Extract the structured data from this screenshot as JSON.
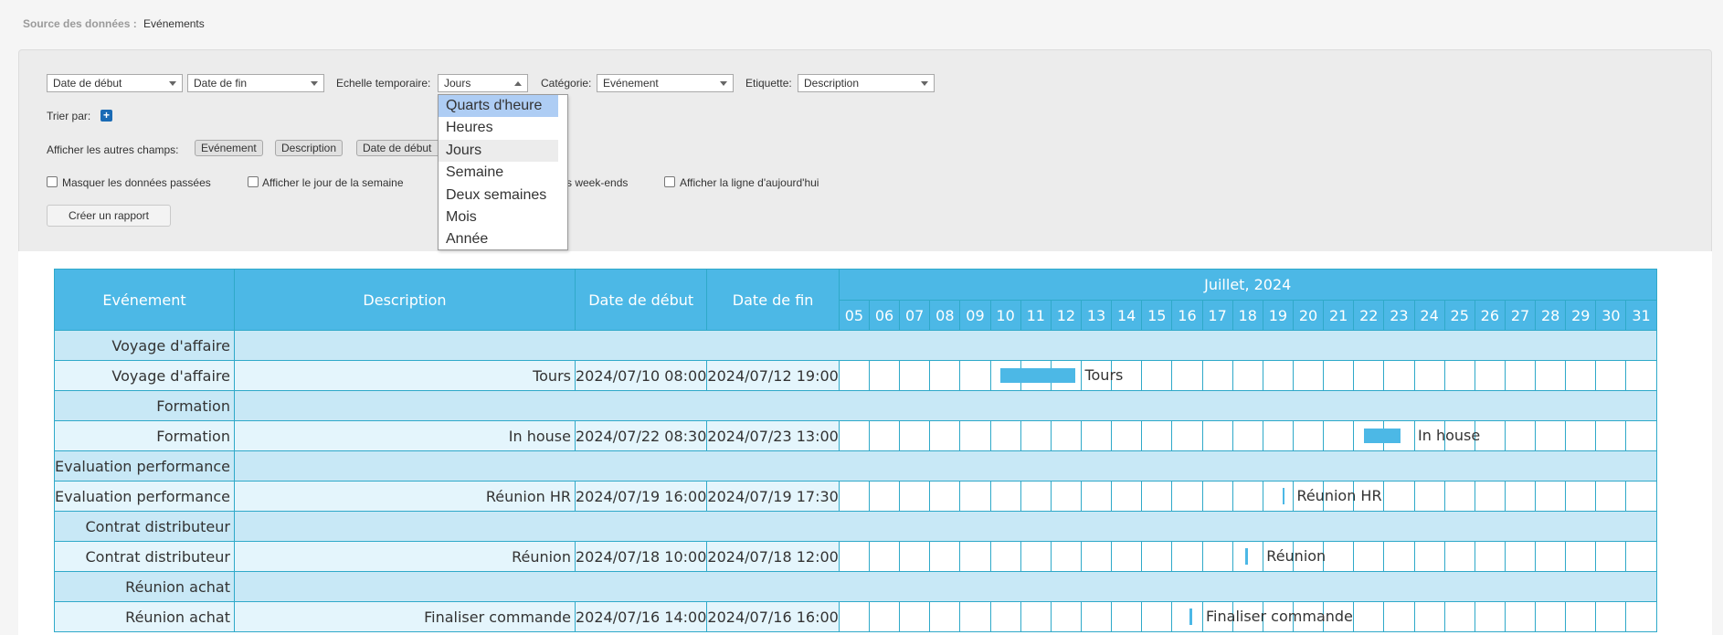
{
  "source": {
    "label": "Source des données :",
    "value": "Evénements"
  },
  "filters": {
    "start_date": "Date de début",
    "end_date": "Date de fin",
    "time_scale_label": "Echelle temporaire:",
    "time_scale_value": "Jours",
    "category_label": "Catégorie:",
    "category_value": "Evénement",
    "tag_label": "Etiquette:",
    "tag_value": "Description"
  },
  "sort_label": "Trier par:",
  "sort_add": "+",
  "other_fields_label": "Afficher les autres champs:",
  "other_fields": [
    "Evénement",
    "Description",
    "Date de début"
  ],
  "checkboxes": {
    "hide_past": "Masquer les données passées",
    "show_weekday": "Afficher le jour de la semaine",
    "weekends": "s week-ends",
    "today_line": "Afficher la ligne d'aujourd'hui"
  },
  "create_report": "Créer un rapport",
  "time_scale_options": [
    "Quarts d'heure",
    "Heures",
    "Jours",
    "Semaine",
    "Deux semaines",
    "Mois",
    "Année"
  ],
  "time_scale_highlighted": "Quarts d'heure",
  "gantt": {
    "headers": {
      "event": "Evénement",
      "description": "Description",
      "start": "Date de début",
      "end": "Date de fin",
      "month": "Juillet, 2024"
    },
    "days": [
      "05",
      "06",
      "07",
      "08",
      "09",
      "10",
      "11",
      "12",
      "13",
      "14",
      "15",
      "16",
      "17",
      "18",
      "19",
      "20",
      "21",
      "22",
      "23",
      "24",
      "25",
      "26",
      "27",
      "28",
      "29",
      "30",
      "31"
    ],
    "groups": [
      {
        "name": "Voyage d'affaire",
        "event": "Voyage d'affaire",
        "description": "Tours",
        "start": "2024/07/10 08:00",
        "end": "2024/07/12 19:00",
        "bar_label": "Tours"
      },
      {
        "name": "Formation",
        "event": "Formation",
        "description": "In house",
        "start": "2024/07/22 08:30",
        "end": "2024/07/23 13:00",
        "bar_label": "In house"
      },
      {
        "name": "Evaluation performance",
        "event": "Evaluation performance",
        "description": "Réunion HR",
        "start": "2024/07/19 16:00",
        "end": "2024/07/19 17:30",
        "bar_label": "Réunion HR"
      },
      {
        "name": "Contrat distributeur",
        "event": "Contrat distributeur",
        "description": "Réunion",
        "start": "2024/07/18 10:00",
        "end": "2024/07/18 12:00",
        "bar_label": "Réunion"
      },
      {
        "name": "Réunion achat",
        "event": "Réunion achat",
        "description": "Finaliser commande",
        "start": "2024/07/16 14:00",
        "end": "2024/07/16 16:00",
        "bar_label": "Finaliser commande"
      }
    ]
  },
  "colors": {
    "header": "#4cb8e6",
    "group_row": "#c8e8f6",
    "data_row": "#e4f5fc",
    "bar": "#4cb8e6",
    "highlight": "#aecdf4"
  }
}
